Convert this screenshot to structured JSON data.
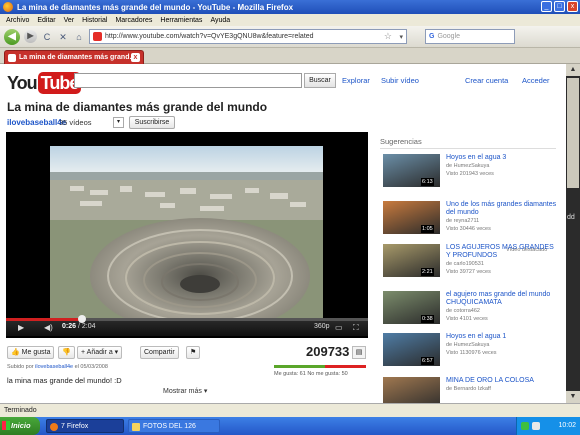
{
  "window": {
    "title": "La mina de diamantes más grande del mundo - YouTube - Mozilla Firefox",
    "controls": {
      "minimize": "_",
      "maximize": "□",
      "close": "x"
    }
  },
  "menu": {
    "items": [
      "Archivo",
      "Editar",
      "Ver",
      "Historial",
      "Marcadores",
      "Herramientas",
      "Ayuda"
    ]
  },
  "toolbar": {
    "url": "http://www.youtube.com/watch?v=QvYE3gQNU8w&feature=related",
    "search_placeholder": "Google",
    "search_engine": "G",
    "back": "◀",
    "forward": "▶",
    "reload": "C",
    "stop": "✕",
    "home": "⌂"
  },
  "tab": {
    "label": "La mina de diamantes más grand...",
    "close": "x"
  },
  "youtube": {
    "logo_you": "You",
    "logo_tube": "Tube",
    "search_button": "Buscar",
    "nav": {
      "explore": "Explorar",
      "upload": "Subir vídeo",
      "create_account": "Crear cuenta",
      "sign_in": "Acceder"
    },
    "video_title": "La mina de diamantes más grande del mundo",
    "channel": "ilovebaseball4e",
    "video_count": "35 vídeos",
    "subscribe": "Suscribirse",
    "player": {
      "time_current": "0:26",
      "time_sep": " / ",
      "time_total": "2:04",
      "quality": "360p",
      "progress": 0.21
    },
    "actions": {
      "like": "Me gusta",
      "add": "Añadir a",
      "share": "Compartir"
    },
    "views": "209733",
    "rating": {
      "likes_fraction": 0.55,
      "text": "Me gusta: 61  No me gusta: 50"
    },
    "uploaded": {
      "prefix": "Subido por",
      "user": "ilovebaseball4e",
      "date": "el 05/03/2008"
    },
    "description": "la mina mas grande del mundo! :D",
    "show_more": "Mostrar más"
  },
  "suggestions": {
    "heading": "Sugerencias",
    "featured_label": "Vídeo destacado",
    "items": [
      {
        "title": "Hoyos en el agua 3",
        "by": "de HumezSakuya",
        "views": "Visto 201943 veces",
        "duration": "6:13",
        "color": "#6b8fa8"
      },
      {
        "title": "Uno de los más grandes diamantes del mundo",
        "by": "de reyna2711",
        "views": "Visto 30446 veces",
        "duration": "1:05",
        "color": "#c97b3e"
      },
      {
        "title": "LOS AGUJEROS MAS GRANDES Y PROFUNDOS",
        "by": "de carlo190531",
        "views": "Visto 39727 veces",
        "duration": "2:21",
        "color": "#a89a6a"
      },
      {
        "title": "el agujero mas grande del mundo CHUQUICAMATA",
        "by": "de cotorra462",
        "views": "Visto 4101 veces",
        "duration": "0:38",
        "color": "#7c8d6c"
      },
      {
        "title": "Hoyos en el agua 1",
        "by": "de HumezSakuya",
        "views": "Visto 1130976 veces",
        "duration": "6:57",
        "color": "#4f7da6"
      },
      {
        "title": "MINA DE ORO LA COLOSA",
        "by": "de Bernardo Izkaff",
        "views": "",
        "duration": "",
        "color": "#a07850"
      }
    ]
  },
  "side_label": "dd",
  "status": {
    "text": "Terminado"
  },
  "taskbar": {
    "start": "Inicio",
    "items": [
      "7 Firefox",
      "FOTOS DEL 126"
    ],
    "clock": "10:02"
  }
}
